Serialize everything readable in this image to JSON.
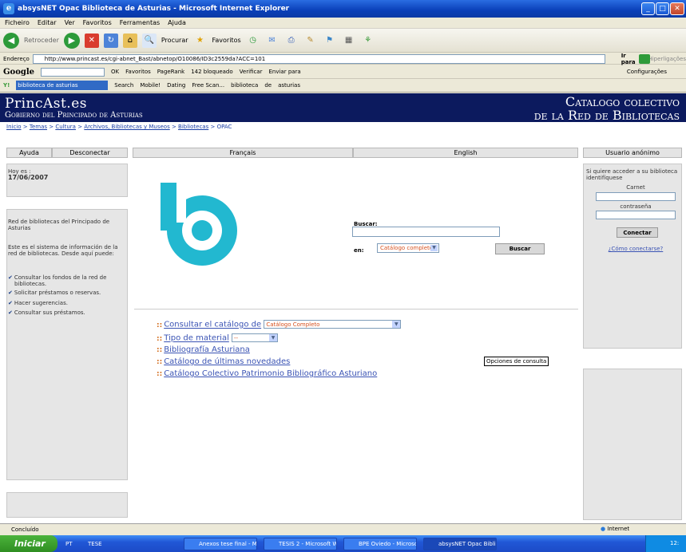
{
  "window": {
    "title": "absysNET Opac Biblioteca de Asturias - Microsoft Internet Explorer"
  },
  "menu": [
    "Ficheiro",
    "Editar",
    "Ver",
    "Favoritos",
    "Ferramentas",
    "Ajuda"
  ],
  "toolbar": {
    "back": "Retroceder",
    "search": "Procurar",
    "favorites": "Favoritos"
  },
  "address": {
    "label": "Endereço",
    "url": "http://www.princast.es/cgi-abnet_Bast/abnetop/O10086/ID3c2559da?ACC=101",
    "go": "Ir para",
    "links": "Hiperligações"
  },
  "google": {
    "logo": "Google",
    "favorites": "Favoritos",
    "pagerank": "PageRank",
    "blocked": "142 bloqueado",
    "check": "Verificar",
    "sendto": "Enviar para",
    "settings": "Configurações"
  },
  "searchbar": {
    "field": "biblioteca de asturias",
    "search": "Search",
    "mobile": "Mobile!",
    "dating": "Dating",
    "freescan": "Free Scan...",
    "term1": "biblioteca",
    "term2": "de",
    "term3": "asturias"
  },
  "banner": {
    "princast": "PrincAst.es",
    "gobierno": "Gobierno del Principado de Asturias",
    "catalogo1": "Catalogo colectivo",
    "catalogo2": "de la Red de Bibliotecas"
  },
  "breadcrumb": {
    "items": [
      "Inicio",
      "Temas",
      "Cultura",
      "Archivos, Bibliotecas y Museos",
      "Bibliotecas"
    ],
    "current": "OPAC",
    "sep": " > "
  },
  "nav": {
    "ayuda": "Ayuda",
    "desconectar": "Desconectar",
    "francais": "Français",
    "english": "English",
    "usuario": "Usuario anónimo"
  },
  "left": {
    "hoy_label": "Hoy es :",
    "date": "17/06/2007",
    "red": "Red de bibliotecas del Principado de Asturias",
    "sistema": "Este es el sistema de información de la red de bibliotecas. Desde aquí puede:",
    "items": [
      "Consultar los fondos de la red de bibliotecas.",
      "Solicitar préstamos o reservas.",
      "Hacer sugerencias.",
      "Consultar sus préstamos."
    ]
  },
  "search": {
    "buscar_label": "Buscar:",
    "en_label": "en:",
    "catalog_select": "Catálogo completo",
    "button": "Buscar"
  },
  "options": {
    "consultar": "Consultar el catálogo de",
    "consultar_select": "Catálogo Completo",
    "tipo": "Tipo de material",
    "tipo_select": "--",
    "bibliografia": "Bibliografía Asturiana",
    "novedades": "Catálogo de últimas novedades",
    "patrimonio": "Catálogo Colectivo Patrimonio Bibliográfico Asturiano",
    "tooltip": "Opciones de consulta"
  },
  "right": {
    "access": "Si quiere acceder a su biblioteca identifíquese",
    "carnet": "Carnet",
    "password": "contraseña",
    "connect": "Conectar",
    "how": "¿Cómo conectarse?"
  },
  "status": {
    "text": "Concluído",
    "zone": "Internet"
  },
  "taskbar": {
    "start": "Iniciar",
    "lang": "PT",
    "tese": "TESE",
    "tasks": [
      "Anexos tese final - Mi...",
      "TESIS 2 - Microsoft W...",
      "BPE Oviedo - Microso...",
      "absysNET Opac Biblio..."
    ],
    "clock": "12:"
  },
  "colors": {
    "banner": "#0c1a5e",
    "logo": "#22b8d0",
    "link": "#3a53b4",
    "accent_orange": "#d36c1c"
  }
}
